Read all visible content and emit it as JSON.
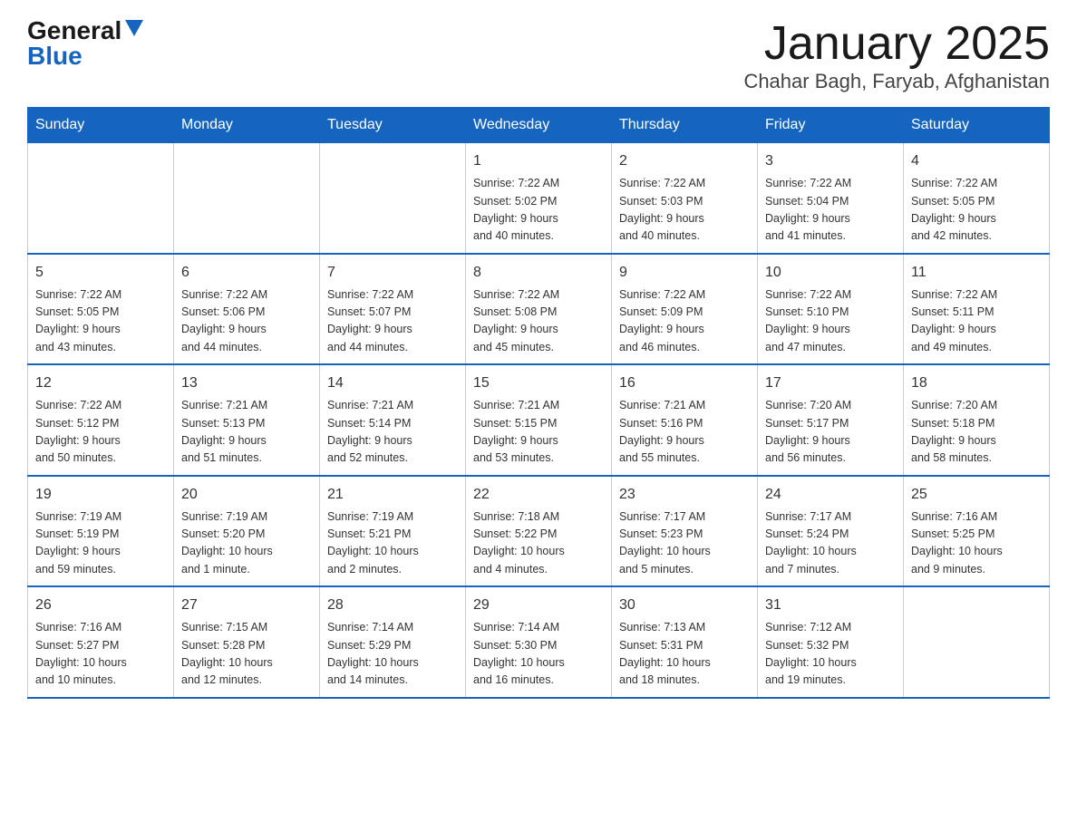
{
  "logo": {
    "general": "General",
    "blue": "Blue"
  },
  "title": "January 2025",
  "subtitle": "Chahar Bagh, Faryab, Afghanistan",
  "weekdays": [
    "Sunday",
    "Monday",
    "Tuesday",
    "Wednesday",
    "Thursday",
    "Friday",
    "Saturday"
  ],
  "weeks": [
    [
      {
        "day": "",
        "info": ""
      },
      {
        "day": "",
        "info": ""
      },
      {
        "day": "",
        "info": ""
      },
      {
        "day": "1",
        "info": "Sunrise: 7:22 AM\nSunset: 5:02 PM\nDaylight: 9 hours\nand 40 minutes."
      },
      {
        "day": "2",
        "info": "Sunrise: 7:22 AM\nSunset: 5:03 PM\nDaylight: 9 hours\nand 40 minutes."
      },
      {
        "day": "3",
        "info": "Sunrise: 7:22 AM\nSunset: 5:04 PM\nDaylight: 9 hours\nand 41 minutes."
      },
      {
        "day": "4",
        "info": "Sunrise: 7:22 AM\nSunset: 5:05 PM\nDaylight: 9 hours\nand 42 minutes."
      }
    ],
    [
      {
        "day": "5",
        "info": "Sunrise: 7:22 AM\nSunset: 5:05 PM\nDaylight: 9 hours\nand 43 minutes."
      },
      {
        "day": "6",
        "info": "Sunrise: 7:22 AM\nSunset: 5:06 PM\nDaylight: 9 hours\nand 44 minutes."
      },
      {
        "day": "7",
        "info": "Sunrise: 7:22 AM\nSunset: 5:07 PM\nDaylight: 9 hours\nand 44 minutes."
      },
      {
        "day": "8",
        "info": "Sunrise: 7:22 AM\nSunset: 5:08 PM\nDaylight: 9 hours\nand 45 minutes."
      },
      {
        "day": "9",
        "info": "Sunrise: 7:22 AM\nSunset: 5:09 PM\nDaylight: 9 hours\nand 46 minutes."
      },
      {
        "day": "10",
        "info": "Sunrise: 7:22 AM\nSunset: 5:10 PM\nDaylight: 9 hours\nand 47 minutes."
      },
      {
        "day": "11",
        "info": "Sunrise: 7:22 AM\nSunset: 5:11 PM\nDaylight: 9 hours\nand 49 minutes."
      }
    ],
    [
      {
        "day": "12",
        "info": "Sunrise: 7:22 AM\nSunset: 5:12 PM\nDaylight: 9 hours\nand 50 minutes."
      },
      {
        "day": "13",
        "info": "Sunrise: 7:21 AM\nSunset: 5:13 PM\nDaylight: 9 hours\nand 51 minutes."
      },
      {
        "day": "14",
        "info": "Sunrise: 7:21 AM\nSunset: 5:14 PM\nDaylight: 9 hours\nand 52 minutes."
      },
      {
        "day": "15",
        "info": "Sunrise: 7:21 AM\nSunset: 5:15 PM\nDaylight: 9 hours\nand 53 minutes."
      },
      {
        "day": "16",
        "info": "Sunrise: 7:21 AM\nSunset: 5:16 PM\nDaylight: 9 hours\nand 55 minutes."
      },
      {
        "day": "17",
        "info": "Sunrise: 7:20 AM\nSunset: 5:17 PM\nDaylight: 9 hours\nand 56 minutes."
      },
      {
        "day": "18",
        "info": "Sunrise: 7:20 AM\nSunset: 5:18 PM\nDaylight: 9 hours\nand 58 minutes."
      }
    ],
    [
      {
        "day": "19",
        "info": "Sunrise: 7:19 AM\nSunset: 5:19 PM\nDaylight: 9 hours\nand 59 minutes."
      },
      {
        "day": "20",
        "info": "Sunrise: 7:19 AM\nSunset: 5:20 PM\nDaylight: 10 hours\nand 1 minute."
      },
      {
        "day": "21",
        "info": "Sunrise: 7:19 AM\nSunset: 5:21 PM\nDaylight: 10 hours\nand 2 minutes."
      },
      {
        "day": "22",
        "info": "Sunrise: 7:18 AM\nSunset: 5:22 PM\nDaylight: 10 hours\nand 4 minutes."
      },
      {
        "day": "23",
        "info": "Sunrise: 7:17 AM\nSunset: 5:23 PM\nDaylight: 10 hours\nand 5 minutes."
      },
      {
        "day": "24",
        "info": "Sunrise: 7:17 AM\nSunset: 5:24 PM\nDaylight: 10 hours\nand 7 minutes."
      },
      {
        "day": "25",
        "info": "Sunrise: 7:16 AM\nSunset: 5:25 PM\nDaylight: 10 hours\nand 9 minutes."
      }
    ],
    [
      {
        "day": "26",
        "info": "Sunrise: 7:16 AM\nSunset: 5:27 PM\nDaylight: 10 hours\nand 10 minutes."
      },
      {
        "day": "27",
        "info": "Sunrise: 7:15 AM\nSunset: 5:28 PM\nDaylight: 10 hours\nand 12 minutes."
      },
      {
        "day": "28",
        "info": "Sunrise: 7:14 AM\nSunset: 5:29 PM\nDaylight: 10 hours\nand 14 minutes."
      },
      {
        "day": "29",
        "info": "Sunrise: 7:14 AM\nSunset: 5:30 PM\nDaylight: 10 hours\nand 16 minutes."
      },
      {
        "day": "30",
        "info": "Sunrise: 7:13 AM\nSunset: 5:31 PM\nDaylight: 10 hours\nand 18 minutes."
      },
      {
        "day": "31",
        "info": "Sunrise: 7:12 AM\nSunset: 5:32 PM\nDaylight: 10 hours\nand 19 minutes."
      },
      {
        "day": "",
        "info": ""
      }
    ]
  ]
}
